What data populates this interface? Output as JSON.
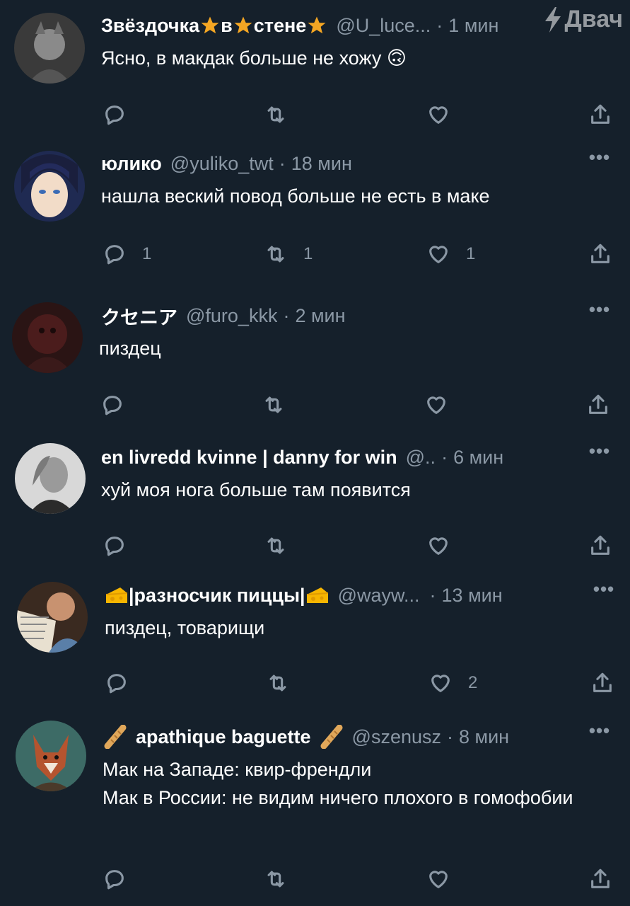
{
  "watermark": "Двач",
  "tweets": [
    {
      "name_parts": [
        "Звёздочка",
        "в",
        "стене"
      ],
      "handle": "@U_luce...",
      "sep": "·",
      "time": "1 мин",
      "text": "Ясно, в макдак больше не хожу 🙃",
      "reply_count": "",
      "retweet_count": "",
      "like_count": ""
    },
    {
      "name": "юлико",
      "handle": "@yuliko_twt",
      "sep": "·",
      "time": "18 мин",
      "text": "нашла веский повод больше не есть в маке",
      "reply_count": "1",
      "retweet_count": "1",
      "like_count": "1"
    },
    {
      "name": "クセニア",
      "handle": "@furo_kkk",
      "sep": "·",
      "time": "2 мин",
      "text": "пиздец",
      "reply_count": "",
      "retweet_count": "",
      "like_count": ""
    },
    {
      "name": "en livredd kvinne | danny for win",
      "handle": "@..",
      "sep": "·",
      "time": "6 мин",
      "text": "хуй моя нога больше там появится",
      "reply_count": "",
      "retweet_count": "",
      "like_count": ""
    },
    {
      "name": "|разносчик пиццы|",
      "handle": "@wayw...",
      "sep": "·",
      "time": "13 мин",
      "text": "пиздец, товарищи",
      "reply_count": "",
      "retweet_count": "",
      "like_count": "2"
    },
    {
      "name": "apathique baguette",
      "handle": "@szenusz",
      "sep": "·",
      "time": "8 мин",
      "text": "Мак на Западе: квир-френдли\nМак в России: не видим ничего плохого в гомофобии",
      "reply_count": "",
      "retweet_count": "",
      "like_count": ""
    }
  ],
  "more_label": "•••",
  "colors": {
    "background": "#15202b",
    "secondary_text": "#8b98a5",
    "primary_text": "#ffffff",
    "star": "#f4a623"
  }
}
